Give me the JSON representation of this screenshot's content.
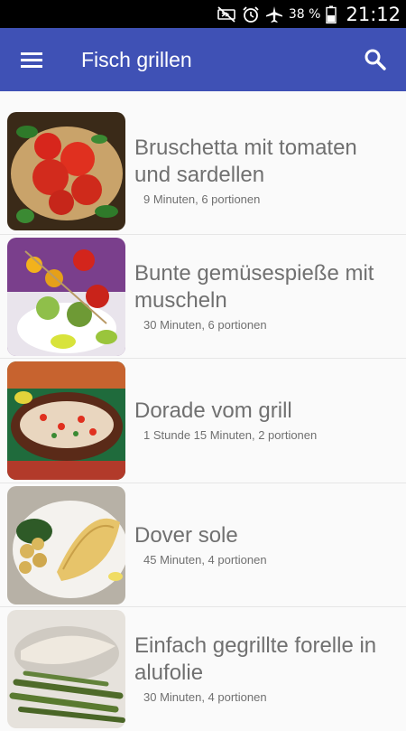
{
  "status_bar": {
    "battery_percent": "38 %",
    "time": "21:12",
    "icons": [
      "mute-icon",
      "alarm-icon",
      "airplane-mode-icon",
      "battery-icon"
    ]
  },
  "app_bar": {
    "title": "Fisch grillen",
    "menu_icon": "hamburger-menu-icon",
    "search_icon": "search-icon",
    "color": "#3f51b5"
  },
  "recipes": [
    {
      "title": "Bruschetta mit tomaten und sardellen",
      "meta": "9 Minuten, 6 portionen",
      "image": "bruschetta-photo"
    },
    {
      "title": "Bunte gemüsespieße mit muscheln",
      "meta": "30 Minuten, 6 portionen",
      "image": "vegetable-skewers-photo"
    },
    {
      "title": "Dorade vom grill",
      "meta": "1 Stunde 15 Minuten, 2 portionen",
      "image": "grilled-dorade-photo"
    },
    {
      "title": "Dover sole",
      "meta": "45 Minuten, 4 portionen",
      "image": "dover-sole-photo"
    },
    {
      "title": "Einfach gegrillte forelle in alufolie",
      "meta": "30 Minuten, 4 portionen",
      "image": "grilled-trout-photo"
    }
  ]
}
